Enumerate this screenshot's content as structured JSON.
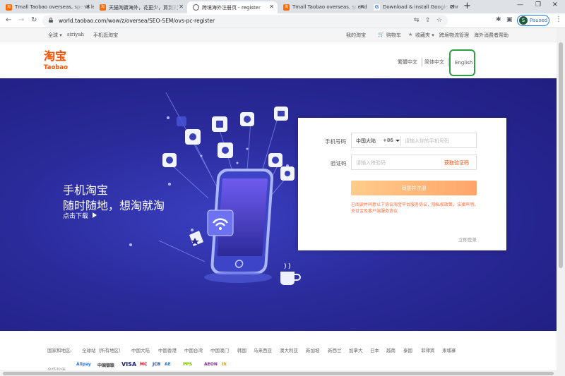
{
  "browser": {
    "tabs": [
      {
        "title": "Tmall Taobao overseas, spend le",
        "favicon": "taobao"
      },
      {
        "title": "天猫淘寶海外，花更少，買到更",
        "favicon": "taobao"
      },
      {
        "title": "跨境海外注册页 - register",
        "favicon": "globe"
      },
      {
        "title": "Tmall Taobao overseas, spend le",
        "favicon": "taobao"
      },
      {
        "title": "Download & install Google Chr",
        "favicon": "google"
      }
    ],
    "url": "world.taobao.com/wow/z/oversea/SEO-SEM/ovs-pc-register",
    "profile_initial": "S",
    "profile_status": "Paused"
  },
  "site_nav": {
    "global": "全球",
    "username": "siriyah",
    "mobile": "手机逛淘宝",
    "my_taobao": "我的淘宝",
    "cart": "购物车",
    "favorites": "收藏夹",
    "logistics": "跨境物流管理",
    "help": "海外消费者帮助"
  },
  "header": {
    "logo_cn": "淘宝",
    "logo_en": "Taobao",
    "lang_traditional": "繁體中文",
    "lang_simplified": "简体中文",
    "lang_english": "English"
  },
  "banner": {
    "slogan_line1": "手机淘宝",
    "slogan_line2": "随时随地，想淘就淘",
    "cta": "点击下载"
  },
  "register": {
    "phone_label": "手机号码",
    "region": "中国大陆",
    "country_code": "+86",
    "phone_placeholder": "请输入你的手机号码",
    "code_label": "验证码",
    "code_placeholder": "请输入校验码",
    "get_code": "获取验证码",
    "submit": "同意并注册",
    "agreement": "已阅读并同意以下协议淘宝平台服务协议，隐私权政策，法律声明，支付宝及客户端服务协议",
    "login_link": "立即登录"
  },
  "footer": {
    "region_label": "国家和地区:",
    "regions": [
      "全球站（所有地区）",
      "中国大陆",
      "中国香港",
      "中国台湾",
      "中国澳门",
      "韩国",
      "马来西亚",
      "澳大利亚",
      "新加坡",
      "新西兰",
      "加拿大",
      "日本",
      "越南",
      "泰国",
      "菲律宾",
      "柬埔寨"
    ],
    "payment_label": "合作伙伴",
    "payments": [
      "Alipay",
      "中国银联",
      "VISA",
      "MC",
      "JCB",
      "AE",
      "PPS",
      "AEON",
      "tk"
    ]
  },
  "colors": {
    "accent": "#ff5000",
    "banner_bg": "#2a2a9a",
    "highlight_box": "#2ea043"
  }
}
